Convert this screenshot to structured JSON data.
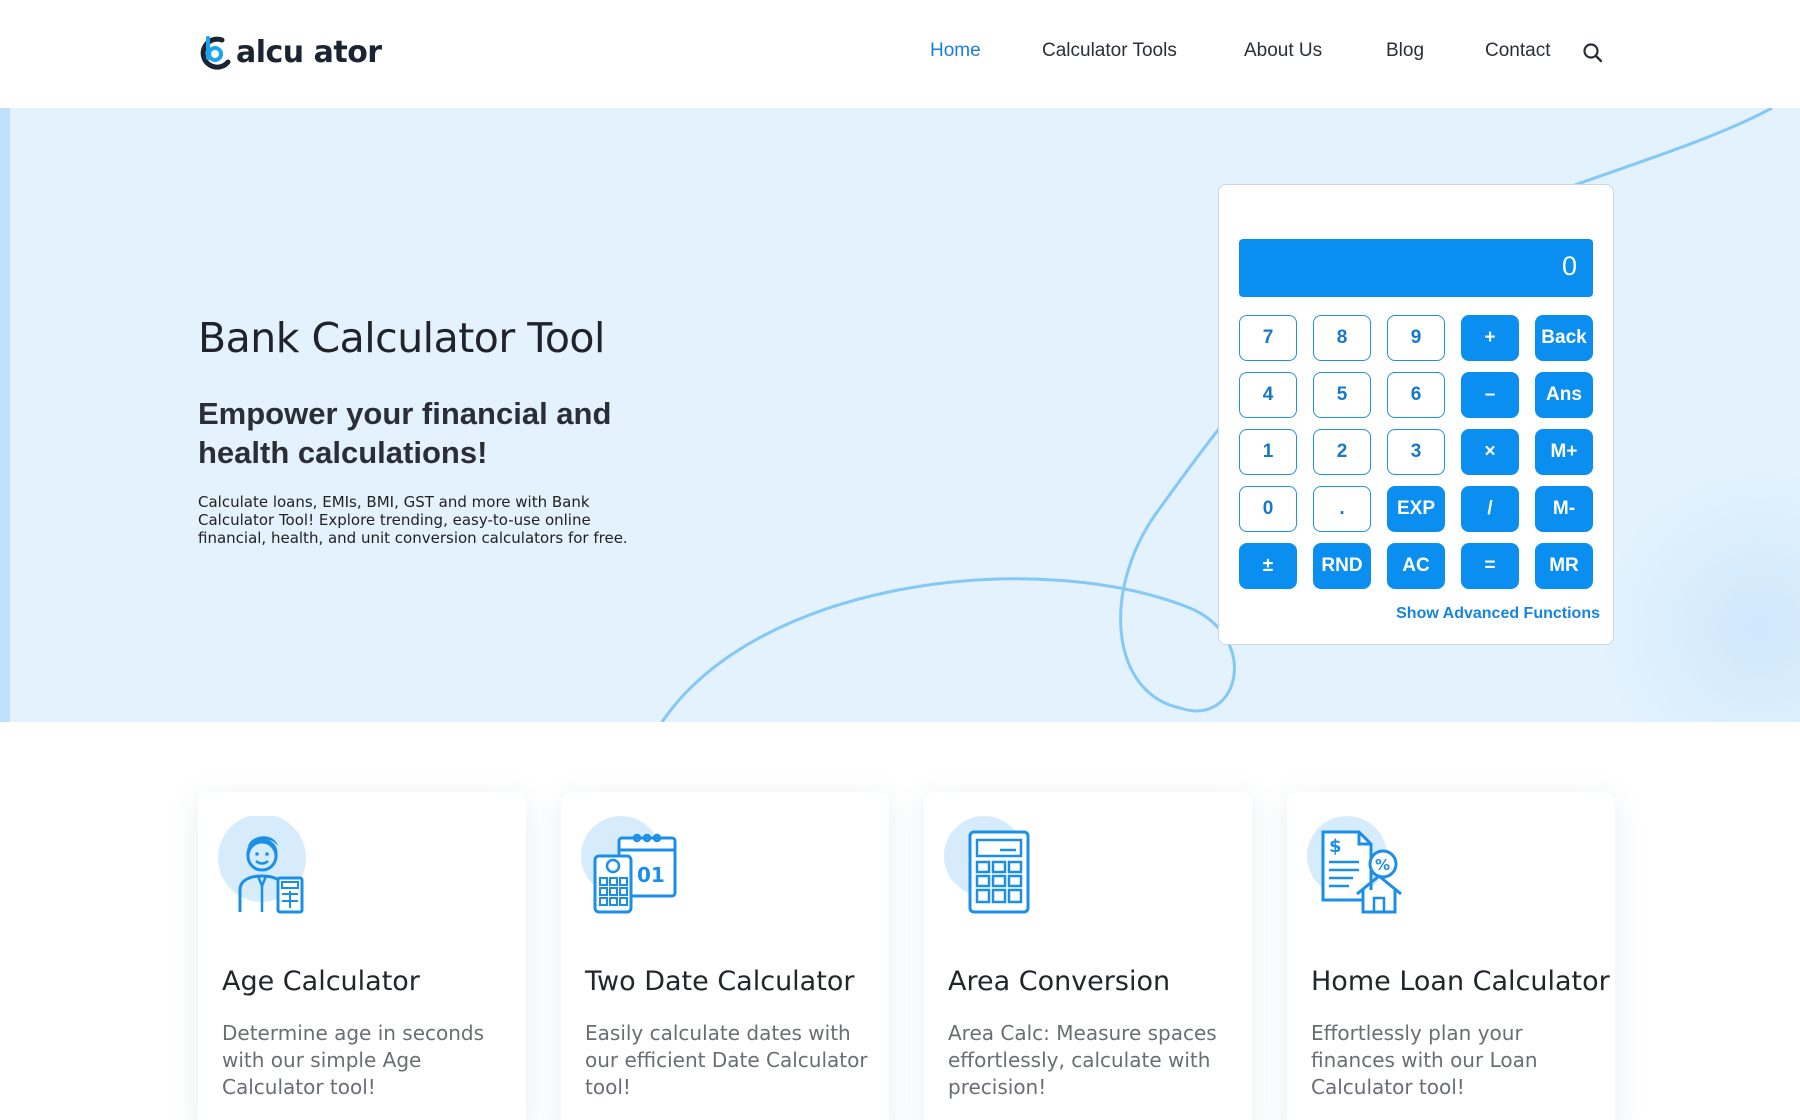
{
  "brand": {
    "logo_text": "alcu ator",
    "colors": {
      "primary": "#0a8ef0",
      "nav_active": "#1c7fd6",
      "hero_bg": "#e3f2fd",
      "dark": "#1b2433"
    }
  },
  "nav": {
    "items": [
      {
        "label": "Home",
        "active": true
      },
      {
        "label": "Calculator Tools",
        "active": false
      },
      {
        "label": "About Us",
        "active": false
      },
      {
        "label": "Blog",
        "active": false
      },
      {
        "label": "Contact",
        "active": false
      }
    ],
    "search_icon": "search-icon"
  },
  "hero": {
    "title": "Bank Calculator Tool",
    "subtitle": "Empower your financial and health calculations!",
    "description": "Calculate loans, EMIs, BMI, GST and more with Bank Calculator Tool! Explore trending, easy-to-use online financial, health, and unit conversion calculators for free."
  },
  "calculator": {
    "display": "0",
    "keys": [
      {
        "label": "7",
        "style": "outline"
      },
      {
        "label": "8",
        "style": "outline"
      },
      {
        "label": "9",
        "style": "outline"
      },
      {
        "label": "+",
        "style": "solid"
      },
      {
        "label": "Back",
        "style": "solid"
      },
      {
        "label": "4",
        "style": "outline"
      },
      {
        "label": "5",
        "style": "outline"
      },
      {
        "label": "6",
        "style": "outline"
      },
      {
        "label": "–",
        "style": "solid"
      },
      {
        "label": "Ans",
        "style": "solid"
      },
      {
        "label": "1",
        "style": "outline"
      },
      {
        "label": "2",
        "style": "outline"
      },
      {
        "label": "3",
        "style": "outline"
      },
      {
        "label": "×",
        "style": "solid"
      },
      {
        "label": "M+",
        "style": "solid"
      },
      {
        "label": "0",
        "style": "outline"
      },
      {
        "label": ".",
        "style": "outline"
      },
      {
        "label": "EXP",
        "style": "solid"
      },
      {
        "label": "/",
        "style": "solid"
      },
      {
        "label": "M-",
        "style": "solid"
      },
      {
        "label": "±",
        "style": "solid"
      },
      {
        "label": "RND",
        "style": "solid"
      },
      {
        "label": "AC",
        "style": "solid"
      },
      {
        "label": "=",
        "style": "solid"
      },
      {
        "label": "MR",
        "style": "solid"
      }
    ],
    "advanced_link": "Show Advanced Functions"
  },
  "cards": [
    {
      "title": "Age Calculator",
      "description": "Determine age in seconds with our simple Age Calculator tool!",
      "icon": "person-calculator-icon"
    },
    {
      "title": "Two Date Calculator",
      "description": "Easily calculate dates with our efficient Date Calculator tool!",
      "icon": "calendar-calculator-icon"
    },
    {
      "title": "Area Conversion",
      "description": "Area Calc: Measure spaces effortlessly, calculate with precision!",
      "icon": "calculator-icon"
    },
    {
      "title": "Home Loan Calculator",
      "description": "Effortlessly plan your finances with our Loan Calculator tool!",
      "icon": "home-loan-icon"
    }
  ]
}
